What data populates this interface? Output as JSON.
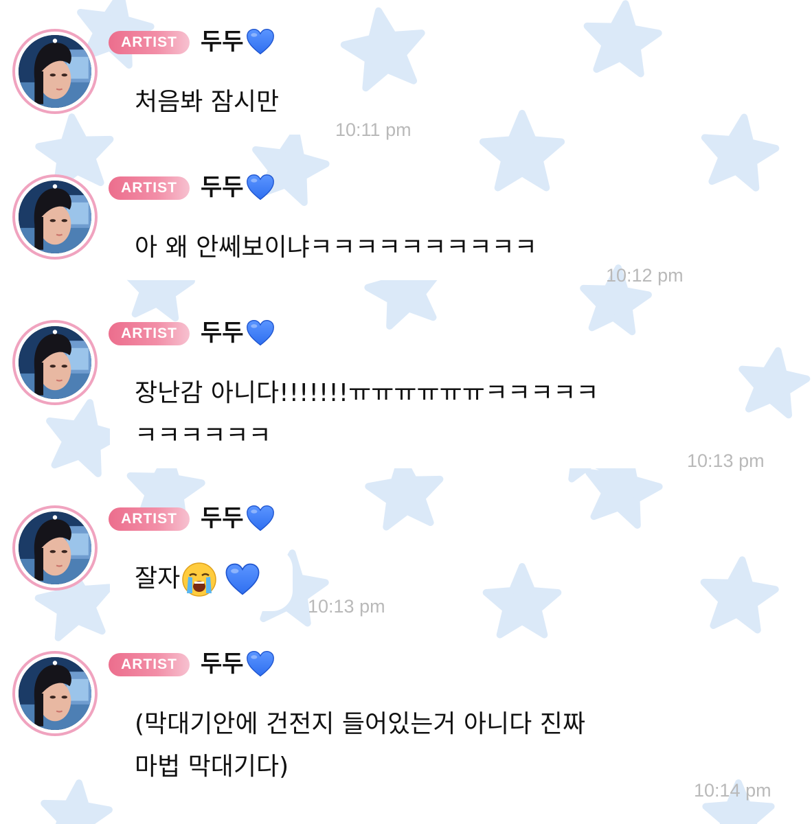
{
  "theme": {
    "star_color": "#dbe9f8",
    "badge_color": "#ee7593",
    "avatar_ring": "#f0a3bf",
    "heart_color": "#2f6ff0",
    "timestamp_color": "#b9b9b9"
  },
  "messages": [
    {
      "badge": "ARTIST",
      "sender": "두두",
      "sender_emoji": "blue-heart",
      "lines": [
        "처음봐 잠시만"
      ],
      "time": "10:11 pm"
    },
    {
      "badge": "ARTIST",
      "sender": "두두",
      "sender_emoji": "blue-heart",
      "lines": [
        "아 왜 안쎄보이냐ㅋㅋㅋㅋㅋㅋㅋㅋㅋㅋ"
      ],
      "time": "10:12 pm"
    },
    {
      "badge": "ARTIST",
      "sender": "두두",
      "sender_emoji": "blue-heart",
      "lines": [
        "장난감 아니다!!!!!!!ㅠㅠㅠㅠㅠㅠㅋㅋㅋㅋㅋ",
        "ㅋㅋㅋㅋㅋㅋ"
      ],
      "time": "10:13 pm"
    },
    {
      "badge": "ARTIST",
      "sender": "두두",
      "sender_emoji": "blue-heart",
      "lines": [
        "잘자"
      ],
      "line_emojis": [
        "loudly-crying-face",
        "blue-heart"
      ],
      "time": "10:13 pm"
    },
    {
      "badge": "ARTIST",
      "sender": "두두",
      "sender_emoji": "blue-heart",
      "lines": [
        "(막대기안에 건전지 들어있는거 아니다 진짜",
        "마법 막대기다)"
      ],
      "time": "10:14 pm"
    }
  ]
}
